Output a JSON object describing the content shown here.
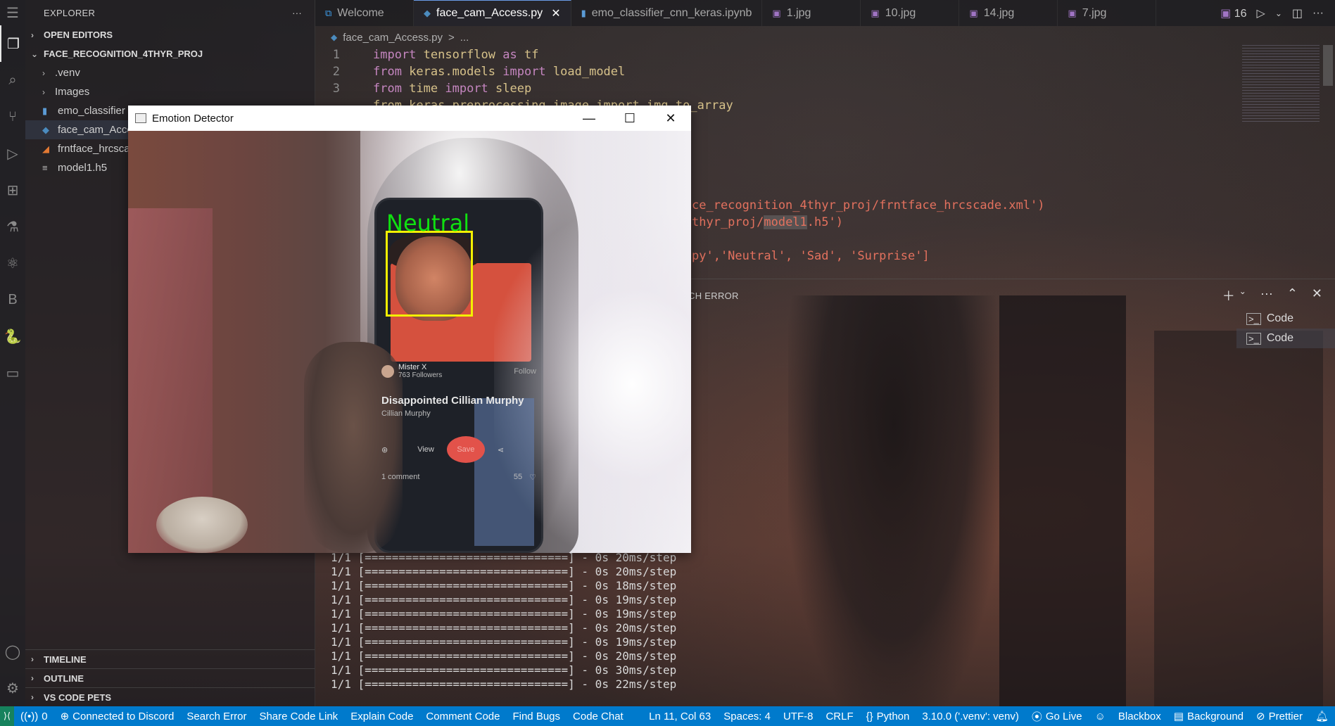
{
  "explorer": {
    "title": "EXPLORER",
    "more": "···",
    "open_editors": "OPEN EDITORS",
    "project": "FACE_RECOGNITION_4THYR_PROJ",
    "items": [
      {
        "label": ".venv",
        "icon": "folder-chevron"
      },
      {
        "label": "Images",
        "icon": "folder-chevron"
      },
      {
        "label": "emo_classifier",
        "icon": "notebook-icon"
      },
      {
        "label": "face_cam_Acce",
        "icon": "python-file-icon"
      },
      {
        "label": "frntface_hrcsca",
        "icon": "rss-xml-icon"
      },
      {
        "label": "model1.h5",
        "icon": "file-lines-icon"
      }
    ],
    "timeline": "TIMELINE",
    "outline": "OUTLINE",
    "pets": "VS CODE PETS"
  },
  "tabs": [
    {
      "label": "Welcome",
      "icon": "vscode-icon"
    },
    {
      "label": "face_cam_Access.py",
      "icon": "python-file-icon",
      "active": true
    },
    {
      "label": "emo_classifier_cnn_keras.ipynb",
      "icon": "notebook-icon"
    },
    {
      "label": "1.jpg",
      "icon": "image-icon"
    },
    {
      "label": "10.jpg",
      "icon": "image-icon"
    },
    {
      "label": "14.jpg",
      "icon": "image-icon"
    },
    {
      "label": "7.jpg",
      "icon": "image-icon"
    }
  ],
  "tab_overflow": "16",
  "breadcrumb": {
    "file": "face_cam_Access.py",
    "sep": ">",
    "rest": "..."
  },
  "code": {
    "l1": {
      "n": "1",
      "a": "import",
      "b": " tensorflow ",
      "c": "as",
      "d": " tf"
    },
    "l2": {
      "n": "2",
      "a": "from",
      "b": " keras.models ",
      "c": "import",
      "d": " load_model"
    },
    "l3": {
      "n": "3",
      "a": "from",
      "b": " time ",
      "c": "import",
      "d": " sleep"
    },
    "l4_partial": "from keras.preprocessing.image import img_to_array",
    "l_xml": "ce_recognition_4thyr_proj/frntface_hrcscade.xml')",
    "l_model_a": "thyr_proj/",
    "l_model_b": "model1",
    "l_model_c": ".h5')",
    "l_labels_a": "py','Neutral', 'Sad', 'Surprise']"
  },
  "panel": {
    "tab_partial": "CH ERROR",
    "terminals": [
      "Code",
      "Code"
    ]
  },
  "terminal_lines": [
    "1/1 [==============================] - 0s 20ms/step",
    "1/1 [==============================] - 0s 20ms/step",
    "1/1 [==============================] - 0s 18ms/step",
    "1/1 [==============================] - 0s 19ms/step",
    "1/1 [==============================] - 0s 19ms/step",
    "1/1 [==============================] - 0s 20ms/step",
    "1/1 [==============================] - 0s 19ms/step",
    "1/1 [==============================] - 0s 20ms/step",
    "1/1 [==============================] - 0s 30ms/step",
    "1/1 [==============================] - 0s 22ms/step"
  ],
  "window": {
    "title": "Emotion Detector",
    "emotion": "Neutral",
    "phone": {
      "user": "Mister X",
      "followers": "763 Followers",
      "follow": "Follow",
      "post_title": "Disappointed Cillian Murphy",
      "post_sub": "Cillian Murphy",
      "view": "View",
      "save": "Save",
      "comment": "1 comment",
      "likes": "55"
    }
  },
  "statusbar": {
    "remote": "⟩⟨",
    "ports": "0",
    "discord": "Connected to Discord",
    "search_error": "Search Error",
    "share": "Share Code Link",
    "explain": "Explain Code",
    "comment": "Comment Code",
    "bugs": "Find Bugs",
    "chat": "Code Chat",
    "position": "Ln 11, Col 63",
    "spaces": "Spaces: 4",
    "encoding": "UTF-8",
    "eol": "CRLF",
    "lang": "Python",
    "interpreter": "3.10.0 ('.venv': venv)",
    "golive": "Go Live",
    "blackbox": "Blackbox",
    "background": "Background",
    "prettier": "Prettier"
  }
}
